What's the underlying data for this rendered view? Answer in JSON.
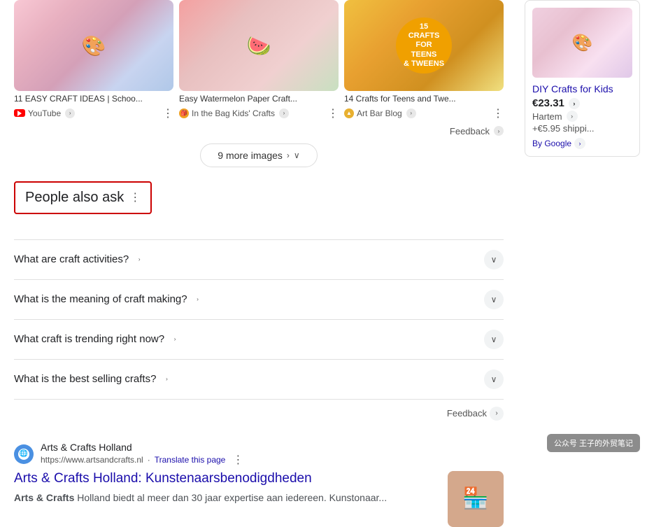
{
  "images": [
    {
      "id": "img1",
      "title": "11 EASY CRAFT IDEAS | Schoo...",
      "source_name": "YouTube",
      "source_type": "youtube",
      "color": "pink-collage"
    },
    {
      "id": "img2",
      "title": "Easy Watermelon Paper Craft...",
      "source_name": "In the Bag Kids' Crafts",
      "source_type": "generic",
      "color": "watermelon"
    },
    {
      "id": "img3",
      "title": "14 Crafts for Teens and Twe...",
      "source_name": "Art Bar Blog",
      "source_type": "artbar",
      "color": "crafts-teens"
    }
  ],
  "more_images_button": "9 more images",
  "people_also_ask": {
    "title": "People also ask",
    "questions": [
      {
        "id": "q1",
        "text": "What are craft activities?"
      },
      {
        "id": "q2",
        "text": "What is the meaning of craft making?"
      },
      {
        "id": "q3",
        "text": "What craft is trending right now?"
      },
      {
        "id": "q4",
        "text": "What is the best selling crafts?"
      }
    ]
  },
  "feedback_label": "Feedback",
  "search_result": {
    "site_name": "Arts & Crafts Holland",
    "url": "https://www.artsandcrafts.nl",
    "translate_label": "Translate this page",
    "title": "Arts & Crafts Holland: Kunstenaarsbenodigdheden",
    "snippet": "Arts & Crafts Holland biedt al meer dan 30 jaar expertise aan iedereen. Kunstenaar..."
  },
  "right_panel": {
    "card": {
      "title": "DIY Crafts for Kids",
      "price": "€23.31",
      "location": "Hartem",
      "shipping": "+€5.95 shippi...",
      "by_label": "By Google"
    }
  },
  "icons": {
    "expand": "∨",
    "feedback_chevron": "›",
    "more_images_chevron": "›",
    "more_images_down": "∨",
    "dots": "⋮",
    "translate_dots": "⋮"
  }
}
